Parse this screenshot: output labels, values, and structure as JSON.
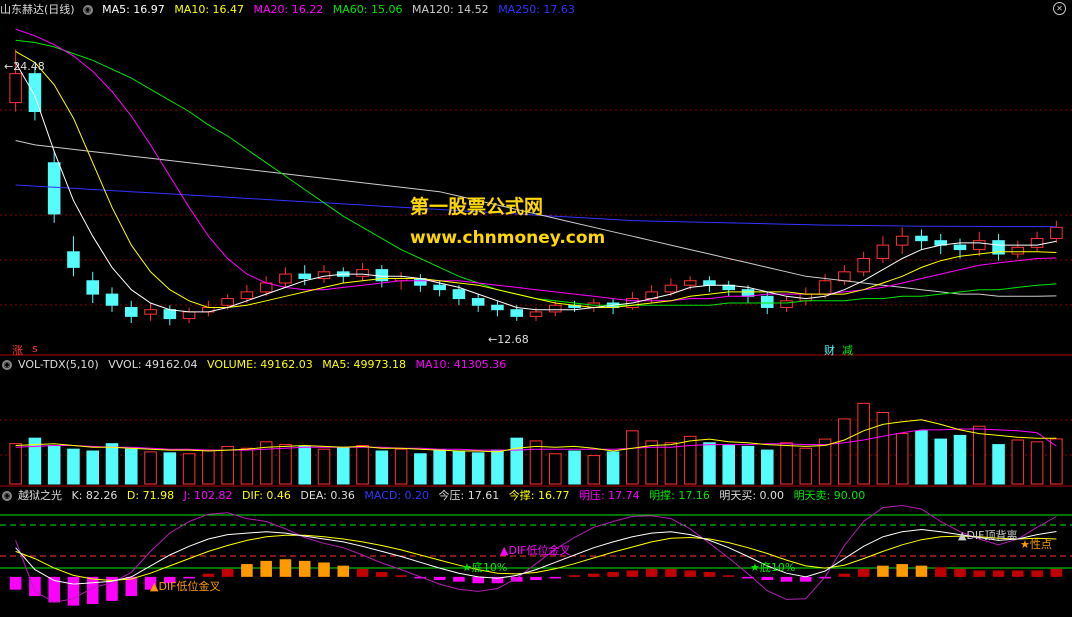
{
  "colors": {
    "up": "#ff3333",
    "down": "#54fcfc",
    "ma5": "#ffffff",
    "ma10": "#ffff00",
    "ma20": "#ff00ff",
    "ma60": "#00e600",
    "ma120": "#cccccc",
    "ma250": "#3333ff",
    "grid": "#8b0000"
  },
  "header": {
    "title": "山东赫达(日线)",
    "ma5": "MA5: 16.97",
    "ma10": "MA10: 16.47",
    "ma20": "MA20: 16.22",
    "ma60": "MA60: 15.06",
    "ma120": "MA120: 14.52",
    "ma250": "MA250: 17.63"
  },
  "price_panel": {
    "high_label": "←24.48",
    "low_label": "←12.68",
    "mark_up": "涨",
    "mark_s": "s",
    "mark_cai": "财",
    "mark_jian": "减"
  },
  "watermark": {
    "line1": "第一股票公式网",
    "line2": "www.chnmoney.com"
  },
  "vol_panel": {
    "name": "VOL-TDX(5,10)",
    "vvol": "VVOL: 49162.04",
    "volume": "VOLUME: 49162.03",
    "ma5": "MA5: 49973.18",
    "ma10": "MA10: 41305.36"
  },
  "ind_panel": {
    "name": "越狱之光",
    "k": "K: 82.26",
    "d": "D: 71.98",
    "j": "J: 102.82",
    "dif": "DIF: 0.46",
    "dea": "DEA: 0.36",
    "macd": "MACD: 0.20",
    "jinya": "今压: 17.61",
    "jincheng": "今撑: 16.77",
    "mingya": "明压: 17.74",
    "mingcheng": "明撑: 17.16",
    "mingmai": "明天买: 0.00",
    "mingmaichu": "明天卖: 90.00",
    "ann_dif_low": "▲DIF低位金叉",
    "ann_dif_top": "▲DIF顶背离",
    "ann_jinchui": "▲DIF低位金叉",
    "ann_di10_a": "★底10%",
    "ann_di10_b": "★底10%",
    "ann_maidian": "★性点"
  },
  "chart_data": {
    "type": "candlestick",
    "price": {
      "ylim": [
        12.0,
        27.0
      ],
      "candles": [
        [
          23.2,
          24.5,
          25.6,
          22.8
        ],
        [
          24.5,
          22.8,
          24.8,
          22.4
        ],
        [
          20.5,
          18.2,
          21.0,
          17.8
        ],
        [
          16.5,
          15.8,
          17.2,
          15.4
        ],
        [
          15.2,
          14.6,
          15.6,
          14.2
        ],
        [
          14.6,
          14.1,
          14.9,
          13.8
        ],
        [
          14.0,
          13.6,
          14.3,
          13.3
        ],
        [
          13.7,
          13.9,
          14.2,
          13.4
        ],
        [
          13.9,
          13.5,
          14.1,
          13.2
        ],
        [
          13.5,
          13.8,
          14.0,
          13.3
        ],
        [
          13.8,
          14.0,
          14.3,
          13.6
        ],
        [
          14.1,
          14.4,
          14.6,
          13.9
        ],
        [
          14.4,
          14.7,
          15.0,
          14.2
        ],
        [
          14.7,
          15.1,
          15.4,
          14.5
        ],
        [
          15.1,
          15.5,
          15.8,
          14.9
        ],
        [
          15.5,
          15.3,
          15.9,
          15.0
        ],
        [
          15.3,
          15.6,
          15.9,
          15.1
        ],
        [
          15.6,
          15.4,
          15.8,
          15.1
        ],
        [
          15.4,
          15.7,
          16.0,
          15.2
        ],
        [
          15.7,
          15.2,
          15.9,
          14.9
        ],
        [
          15.2,
          15.3,
          15.6,
          14.8
        ],
        [
          15.3,
          15.0,
          15.5,
          14.7
        ],
        [
          15.0,
          14.8,
          15.2,
          14.5
        ],
        [
          14.8,
          14.4,
          15.0,
          14.1
        ],
        [
          14.4,
          14.1,
          14.6,
          13.8
        ],
        [
          14.1,
          13.9,
          14.3,
          13.6
        ],
        [
          13.9,
          13.6,
          14.1,
          13.4
        ],
        [
          13.6,
          13.8,
          14.0,
          13.4
        ],
        [
          13.8,
          14.1,
          14.3,
          13.6
        ],
        [
          14.1,
          14.0,
          14.3,
          13.8
        ],
        [
          14.0,
          14.2,
          14.4,
          13.8
        ],
        [
          14.2,
          14.0,
          14.4,
          13.7
        ],
        [
          14.0,
          14.4,
          14.7,
          13.9
        ],
        [
          14.4,
          14.7,
          15.0,
          14.2
        ],
        [
          14.7,
          15.0,
          15.3,
          14.5
        ],
        [
          15.0,
          15.2,
          15.4,
          14.8
        ],
        [
          15.2,
          15.0,
          15.4,
          14.7
        ],
        [
          15.0,
          14.8,
          15.2,
          14.5
        ],
        [
          14.8,
          14.5,
          15.0,
          14.2
        ],
        [
          14.5,
          14.0,
          14.7,
          13.7
        ],
        [
          14.0,
          14.3,
          14.5,
          13.8
        ],
        [
          14.3,
          14.6,
          14.9,
          14.1
        ],
        [
          14.6,
          15.2,
          15.5,
          14.4
        ],
        [
          15.2,
          15.6,
          15.9,
          15.0
        ],
        [
          15.6,
          16.2,
          16.5,
          15.4
        ],
        [
          16.2,
          16.8,
          17.2,
          16.0
        ],
        [
          16.8,
          17.2,
          17.6,
          16.4
        ],
        [
          17.2,
          17.0,
          17.5,
          16.6
        ],
        [
          17.0,
          16.8,
          17.3,
          16.4
        ],
        [
          16.8,
          16.6,
          17.1,
          16.2
        ],
        [
          16.6,
          17.0,
          17.4,
          16.3
        ],
        [
          17.0,
          16.4,
          17.3,
          16.1
        ],
        [
          16.4,
          16.7,
          17.0,
          16.2
        ],
        [
          16.7,
          17.1,
          17.4,
          16.5
        ],
        [
          17.1,
          17.6,
          17.9,
          16.9
        ]
      ],
      "ma5": [
        25.0,
        23.5,
        21.0,
        18.8,
        17.2,
        15.8,
        14.8,
        14.2,
        13.9,
        13.8,
        13.8,
        14.0,
        14.3,
        14.6,
        14.9,
        15.2,
        15.4,
        15.5,
        15.5,
        15.4,
        15.4,
        15.3,
        15.1,
        14.9,
        14.6,
        14.3,
        14.0,
        13.9,
        13.9,
        13.9,
        14.0,
        14.1,
        14.2,
        14.4,
        14.6,
        14.9,
        15.0,
        15.0,
        14.9,
        14.7,
        14.5,
        14.4,
        14.5,
        14.8,
        15.2,
        15.7,
        16.2,
        16.6,
        16.8,
        16.9,
        16.9,
        16.8,
        16.8,
        16.8,
        16.97
      ],
      "ma10": [
        25.5,
        25.0,
        24.0,
        22.5,
        20.5,
        18.5,
        16.8,
        15.6,
        14.8,
        14.3,
        14.0,
        14.0,
        14.1,
        14.3,
        14.5,
        14.7,
        14.9,
        15.1,
        15.2,
        15.3,
        15.3,
        15.3,
        15.2,
        15.1,
        15.0,
        14.8,
        14.6,
        14.4,
        14.2,
        14.1,
        14.0,
        14.0,
        14.1,
        14.2,
        14.3,
        14.5,
        14.6,
        14.7,
        14.7,
        14.7,
        14.7,
        14.6,
        14.6,
        14.6,
        14.8,
        15.1,
        15.4,
        15.8,
        16.1,
        16.3,
        16.4,
        16.5,
        16.5,
        16.5,
        16.47
      ],
      "ma20": [
        26.5,
        26.2,
        25.8,
        25.3,
        24.6,
        23.7,
        22.6,
        21.3,
        19.9,
        18.5,
        17.2,
        16.2,
        15.5,
        15.1,
        14.9,
        14.8,
        14.8,
        14.9,
        15.0,
        15.1,
        15.2,
        15.2,
        15.2,
        15.2,
        15.1,
        15.0,
        14.9,
        14.8,
        14.7,
        14.6,
        14.5,
        14.4,
        14.3,
        14.3,
        14.3,
        14.4,
        14.4,
        14.5,
        14.5,
        14.6,
        14.6,
        14.6,
        14.6,
        14.7,
        14.8,
        14.9,
        15.1,
        15.3,
        15.5,
        15.7,
        15.9,
        16.0,
        16.1,
        16.2,
        16.22
      ],
      "ma60": [
        26.0,
        25.9,
        25.7,
        25.4,
        25.1,
        24.7,
        24.3,
        23.8,
        23.3,
        22.8,
        22.2,
        21.7,
        21.1,
        20.5,
        19.9,
        19.3,
        18.7,
        18.1,
        17.6,
        17.1,
        16.6,
        16.2,
        15.8,
        15.4,
        15.1,
        14.8,
        14.6,
        14.4,
        14.3,
        14.2,
        14.1,
        14.1,
        14.1,
        14.1,
        14.1,
        14.1,
        14.1,
        14.2,
        14.2,
        14.2,
        14.2,
        14.3,
        14.3,
        14.3,
        14.4,
        14.4,
        14.5,
        14.5,
        14.6,
        14.7,
        14.8,
        14.8,
        14.9,
        15.0,
        15.06
      ],
      "ma120": [
        21.5,
        21.3,
        21.2,
        21.1,
        21.0,
        20.9,
        20.8,
        20.7,
        20.6,
        20.5,
        20.4,
        20.3,
        20.2,
        20.1,
        20.0,
        19.9,
        19.8,
        19.7,
        19.6,
        19.5,
        19.4,
        19.3,
        19.2,
        19.0,
        18.8,
        18.6,
        18.4,
        18.2,
        18.0,
        17.8,
        17.6,
        17.4,
        17.2,
        17.0,
        16.8,
        16.6,
        16.4,
        16.2,
        16.0,
        15.8,
        15.6,
        15.4,
        15.3,
        15.2,
        15.1,
        15.0,
        14.9,
        14.8,
        14.7,
        14.6,
        14.6,
        14.5,
        14.5,
        14.5,
        14.52
      ],
      "ma250": [
        19.5,
        19.45,
        19.4,
        19.35,
        19.3,
        19.25,
        19.2,
        19.15,
        19.1,
        19.05,
        19.0,
        18.95,
        18.9,
        18.85,
        18.8,
        18.75,
        18.7,
        18.65,
        18.6,
        18.55,
        18.5,
        18.45,
        18.4,
        18.35,
        18.3,
        18.25,
        18.2,
        18.15,
        18.1,
        18.05,
        18.0,
        17.95,
        17.9,
        17.88,
        17.86,
        17.84,
        17.82,
        17.8,
        17.78,
        17.76,
        17.74,
        17.72,
        17.7,
        17.69,
        17.68,
        17.67,
        17.66,
        17.65,
        17.65,
        17.64,
        17.64,
        17.63,
        17.63,
        17.63,
        17.63
      ]
    },
    "volume": {
      "ylim": [
        0,
        120000
      ],
      "values": [
        44000,
        50000,
        42000,
        38000,
        36000,
        44000,
        38000,
        35000,
        34000,
        33000,
        37000,
        41000,
        39000,
        46000,
        43000,
        41000,
        38000,
        40000,
        42000,
        36000,
        38000,
        33000,
        37000,
        36000,
        34000,
        37000,
        50000,
        47000,
        33000,
        36000,
        31000,
        35000,
        58000,
        47000,
        45000,
        52000,
        45000,
        42000,
        41000,
        37000,
        45000,
        39000,
        49000,
        71000,
        88000,
        78000,
        55000,
        58000,
        49000,
        53000,
        63000,
        43000,
        48000,
        46000,
        49162
      ],
      "ma5": [
        42000,
        43000,
        44000,
        42000,
        40000,
        40000,
        39000,
        38000,
        37000,
        37000,
        36000,
        37000,
        38000,
        40000,
        41000,
        42000,
        41000,
        40000,
        41000,
        39000,
        39000,
        38000,
        37000,
        36000,
        36000,
        35000,
        39000,
        41000,
        40000,
        41000,
        39000,
        36000,
        39000,
        42000,
        43000,
        47000,
        49000,
        46000,
        45000,
        43000,
        42000,
        41000,
        42000,
        48000,
        58000,
        65000,
        68000,
        70000,
        65000,
        59000,
        55000,
        53000,
        51000,
        50000,
        49973
      ],
      "ma10": [
        40000,
        41000,
        42000,
        42000,
        41000,
        40000,
        40000,
        39000,
        38000,
        38000,
        37000,
        37000,
        37000,
        38000,
        39000,
        40000,
        40000,
        40000,
        40000,
        40000,
        39000,
        39000,
        38000,
        38000,
        37000,
        37000,
        37000,
        38000,
        38000,
        38000,
        38000,
        38000,
        39000,
        40000,
        40000,
        42000,
        43000,
        43000,
        43000,
        44000,
        44000,
        43000,
        43000,
        45000,
        48000,
        52000,
        56000,
        59000,
        59000,
        60000,
        60000,
        59000,
        58000,
        56000,
        41305
      ]
    },
    "indicator": {
      "ylim": [
        -20,
        120
      ],
      "k": [
        60,
        30,
        15,
        10,
        12,
        14,
        20,
        35,
        50,
        62,
        72,
        78,
        80,
        82,
        80,
        76,
        72,
        68,
        62,
        55,
        48,
        40,
        32,
        25,
        20,
        18,
        22,
        30,
        40,
        50,
        60,
        68,
        75,
        80,
        82,
        78,
        70,
        60,
        48,
        35,
        25,
        20,
        28,
        45,
        62,
        75,
        82,
        85,
        82,
        78,
        74,
        70,
        72,
        78,
        82.26
      ],
      "d": [
        55,
        45,
        32,
        22,
        17,
        15,
        17,
        25,
        35,
        45,
        55,
        63,
        70,
        75,
        77,
        77,
        75,
        72,
        68,
        63,
        57,
        50,
        43,
        36,
        30,
        25,
        24,
        26,
        31,
        38,
        46,
        54,
        61,
        68,
        73,
        74,
        72,
        67,
        60,
        52,
        43,
        35,
        32,
        36,
        45,
        55,
        64,
        71,
        75,
        76,
        75,
        73,
        72,
        73,
        71.98
      ],
      "j": [
        70,
        0,
        -15,
        -10,
        5,
        12,
        26,
        55,
        80,
        96,
        106,
        108,
        100,
        96,
        86,
        74,
        66,
        60,
        50,
        39,
        30,
        20,
        10,
        3,
        0,
        4,
        18,
        38,
        58,
        74,
        88,
        96,
        103,
        104,
        100,
        86,
        66,
        46,
        24,
        1,
        -11,
        -10,
        20,
        63,
        96,
        115,
        118,
        113,
        96,
        82,
        72,
        64,
        72,
        88,
        102.82
      ],
      "macd": [
        -8,
        -12,
        -16,
        -18,
        -17,
        -15,
        -12,
        -8,
        -4,
        -1,
        2,
        5,
        8,
        10,
        11,
        10,
        9,
        7,
        5,
        3,
        1,
        -1,
        -2,
        -3,
        -4,
        -4,
        -3,
        -2,
        -1,
        1,
        2,
        3,
        4,
        5,
        5,
        4,
        3,
        1,
        -1,
        -2,
        -3,
        -3,
        -1,
        2,
        5,
        7,
        8,
        7,
        6,
        5,
        4,
        4,
        4,
        4,
        5
      ]
    }
  }
}
